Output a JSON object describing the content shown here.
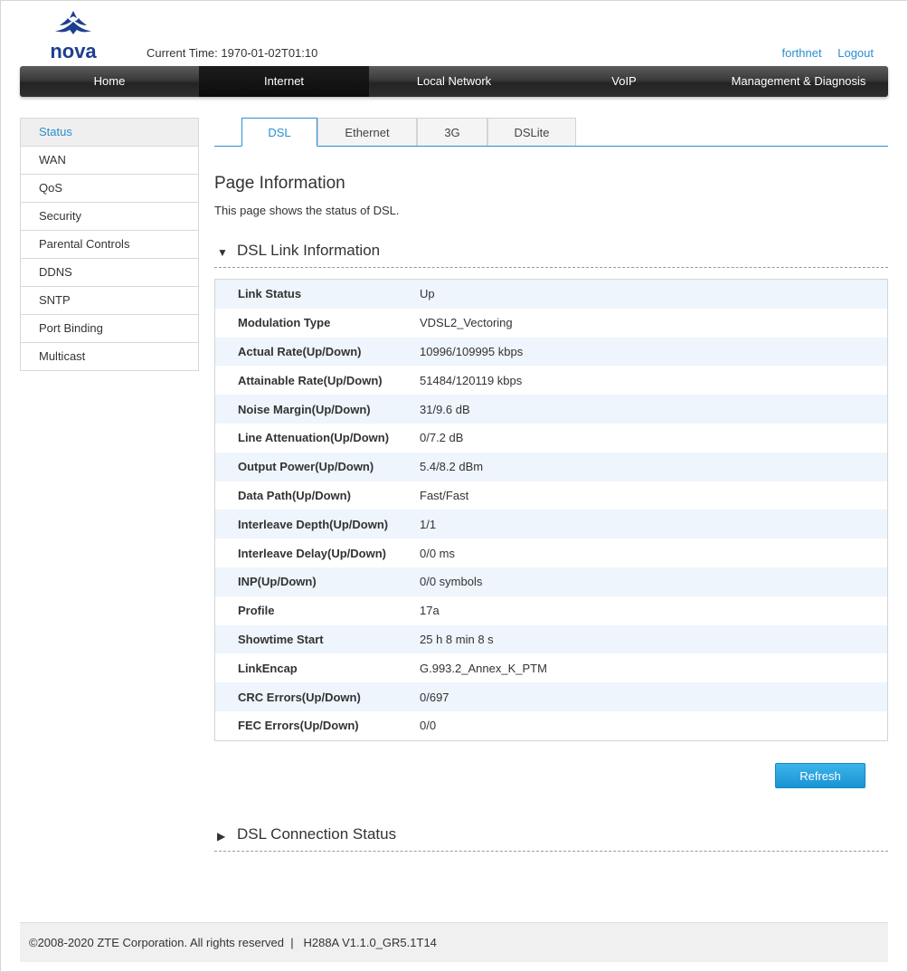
{
  "header": {
    "logo_text": "nova",
    "current_time_label": "Current Time:",
    "current_time_value": "1970-01-02T01:10",
    "user_link": "forthnet",
    "logout_link": "Logout"
  },
  "nav": {
    "items": [
      "Home",
      "Internet",
      "Local Network",
      "VoIP",
      "Management & Diagnosis"
    ],
    "active": "Internet"
  },
  "sidebar": {
    "items": [
      "Status",
      "WAN",
      "QoS",
      "Security",
      "Parental Controls",
      "DDNS",
      "SNTP",
      "Port Binding",
      "Multicast"
    ],
    "active": "Status"
  },
  "tabs": {
    "items": [
      "DSL",
      "Ethernet",
      "3G",
      "DSLite"
    ],
    "active": "DSL"
  },
  "page": {
    "title": "Page Information",
    "description": "This page shows the status of DSL."
  },
  "dsl_link": {
    "heading": "DSL Link Information",
    "expanded": true,
    "rows": [
      {
        "label": "Link Status",
        "value": "Up"
      },
      {
        "label": "Modulation Type",
        "value": "VDSL2_Vectoring"
      },
      {
        "label": "Actual Rate(Up/Down)",
        "value": "10996/109995 kbps"
      },
      {
        "label": "Attainable Rate(Up/Down)",
        "value": "51484/120119 kbps"
      },
      {
        "label": "Noise Margin(Up/Down)",
        "value": "31/9.6 dB"
      },
      {
        "label": "Line Attenuation(Up/Down)",
        "value": "0/7.2 dB"
      },
      {
        "label": "Output Power(Up/Down)",
        "value": "5.4/8.2 dBm"
      },
      {
        "label": "Data Path(Up/Down)",
        "value": "Fast/Fast"
      },
      {
        "label": "Interleave Depth(Up/Down)",
        "value": "1/1"
      },
      {
        "label": "Interleave Delay(Up/Down)",
        "value": "0/0 ms"
      },
      {
        "label": "INP(Up/Down)",
        "value": "0/0 symbols"
      },
      {
        "label": "Profile",
        "value": "17a"
      },
      {
        "label": "Showtime Start",
        "value": "25 h 8 min 8 s"
      },
      {
        "label": "LinkEncap",
        "value": "G.993.2_Annex_K_PTM"
      },
      {
        "label": "CRC Errors(Up/Down)",
        "value": "0/697"
      },
      {
        "label": "FEC Errors(Up/Down)",
        "value": "0/0"
      }
    ],
    "refresh_label": "Refresh"
  },
  "dsl_connection": {
    "heading": "DSL Connection Status",
    "expanded": false
  },
  "footer": {
    "copyright": "©2008-2020 ZTE Corporation. All rights reserved",
    "separator": "|",
    "version": "H288A V1.1.0_GR5.1T14"
  },
  "colors": {
    "accent": "#2a8fd0",
    "logo_blue": "#1d3f8f",
    "nav_dark": "#2e2e2e",
    "row_alt": "#eef5fc"
  },
  "icons": {
    "expanded_arrow": "triangle-down-icon",
    "collapsed_arrow": "triangle-right-icon"
  }
}
